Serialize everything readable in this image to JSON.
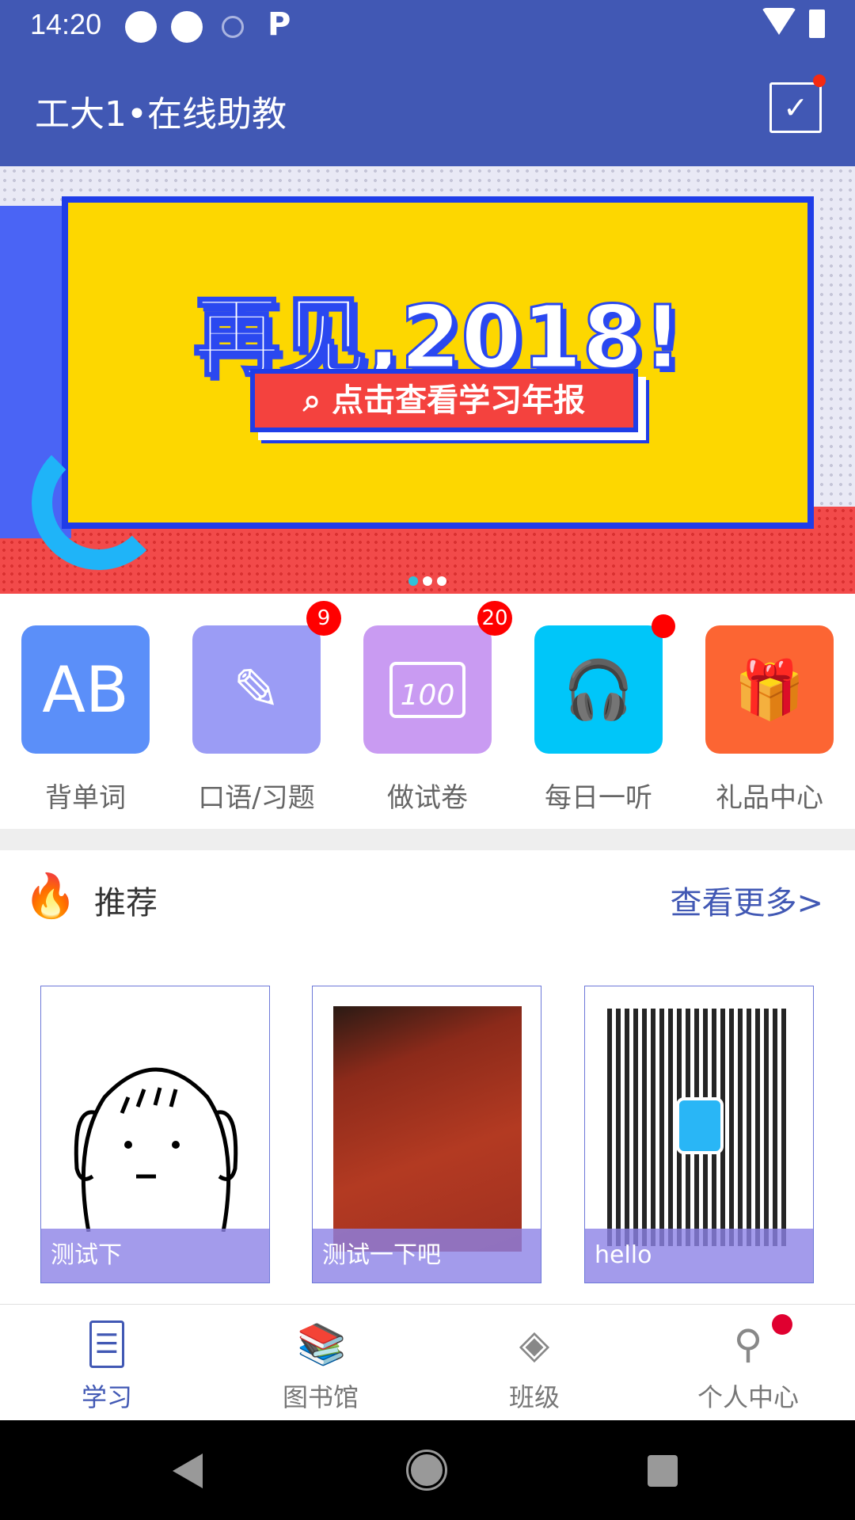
{
  "status_bar": {
    "time": "14:20"
  },
  "app_bar": {
    "title": "工大1•在线助教",
    "calendar_icon": "calendar-check-icon"
  },
  "banner": {
    "headline": "再见,2018!",
    "button": "点击查看学习年报",
    "slide_count": 3,
    "active_slide": 1
  },
  "features": [
    {
      "label": "背单词",
      "icon_text": "AB",
      "color": "#5b8ff9"
    },
    {
      "label": "口语/习题",
      "icon_text": "✎",
      "color": "#9b9cf5",
      "badge": "9"
    },
    {
      "label": "做试卷",
      "icon_text": "100",
      "color": "#c99bf2",
      "badge": "20"
    },
    {
      "label": "每日一听",
      "icon_text": "🎧",
      "color": "#00c6f9",
      "dot": true
    },
    {
      "label": "礼品中心",
      "icon_text": "🎁",
      "color": "#fc6533"
    }
  ],
  "recommend": {
    "title": "推荐",
    "more": "查看更多>",
    "items": [
      {
        "caption": "测试下"
      },
      {
        "caption": "测试一下吧"
      },
      {
        "caption": "hello"
      }
    ]
  },
  "bottom_nav": [
    {
      "label": "学习",
      "active": true
    },
    {
      "label": "图书馆"
    },
    {
      "label": "班级"
    },
    {
      "label": "个人中心",
      "dot": true
    }
  ],
  "accent": "#4158b4"
}
